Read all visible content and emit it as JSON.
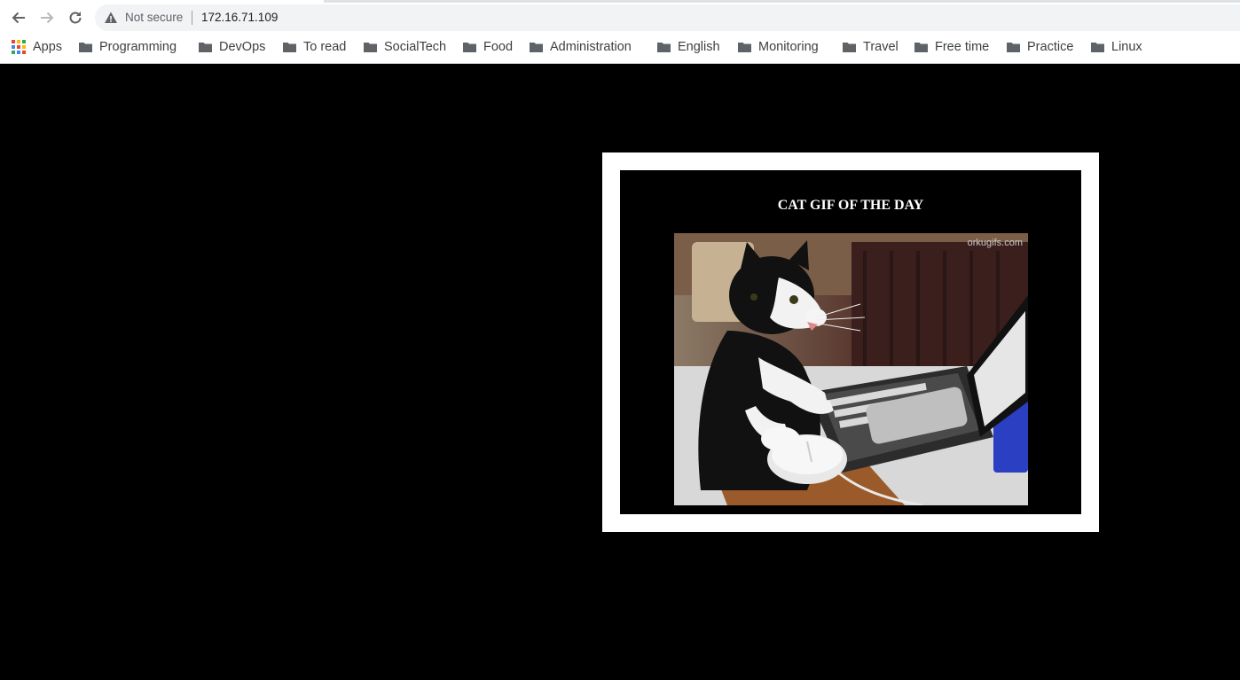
{
  "browser": {
    "security_label": "Not secure",
    "url": "172.16.71.109",
    "apps_label": "Apps",
    "bookmarks": [
      "Programming",
      "DevOps",
      "To read",
      "SocialTech",
      "Food",
      "Administration",
      "English",
      "Monitoring",
      "Travel",
      "Free time",
      "Practice",
      "Linux"
    ]
  },
  "page": {
    "title": "CAT GIF OF THE DAY",
    "image_watermark": "orkugifs.com"
  }
}
